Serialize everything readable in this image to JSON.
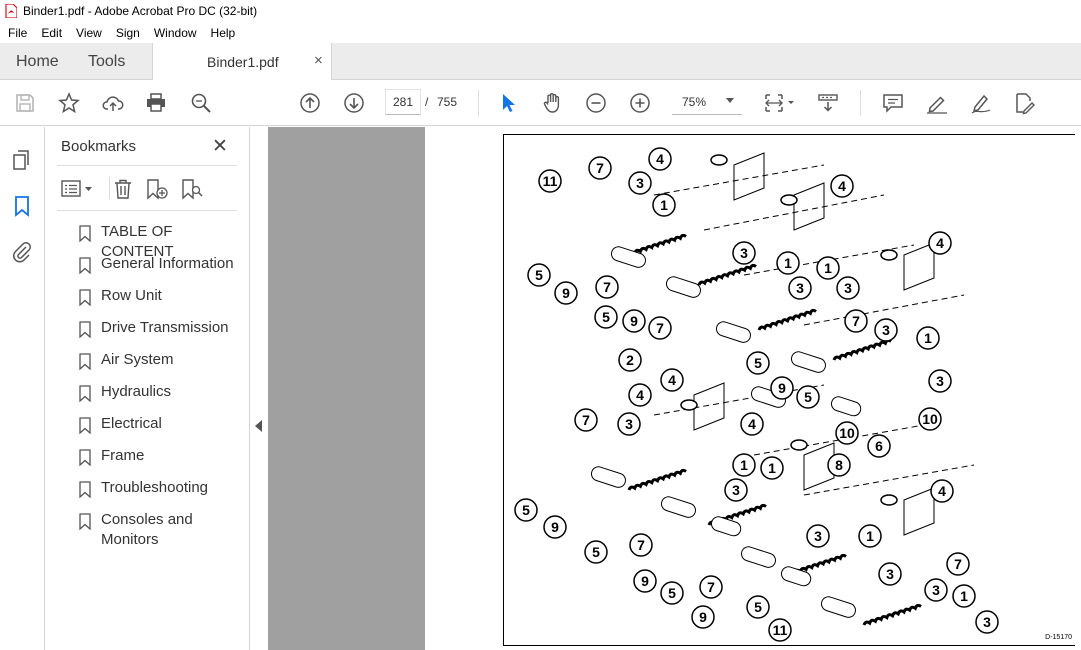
{
  "window": {
    "title": "Binder1.pdf - Adobe Acrobat Pro DC (32-bit)"
  },
  "menu": [
    "File",
    "Edit",
    "View",
    "Sign",
    "Window",
    "Help"
  ],
  "tabs": {
    "home": "Home",
    "tools": "Tools",
    "document": "Binder1.pdf",
    "close_glyph": "×"
  },
  "toolbar": {
    "current_page": "281",
    "page_separator": "/",
    "total_pages": "755",
    "zoom": "75%"
  },
  "bookmarks": {
    "title": "Bookmarks",
    "close_glyph": "✕",
    "items": [
      "TABLE OF CONTENT",
      "General Information",
      "Row Unit",
      "Drive Transmission",
      "Air System",
      "Hydraulics",
      "Electrical",
      "Frame",
      "Troubleshooting",
      "Consoles and Monitors"
    ]
  },
  "diagram": {
    "reference_code": "D-15170",
    "callouts": [
      "1",
      "2",
      "3",
      "4",
      "5",
      "6",
      "7",
      "8",
      "9",
      "10",
      "11"
    ]
  },
  "colors": {
    "accent": "#1473e6",
    "panel_gray": "#a0a0a0",
    "tab_bar": "#ececec"
  }
}
